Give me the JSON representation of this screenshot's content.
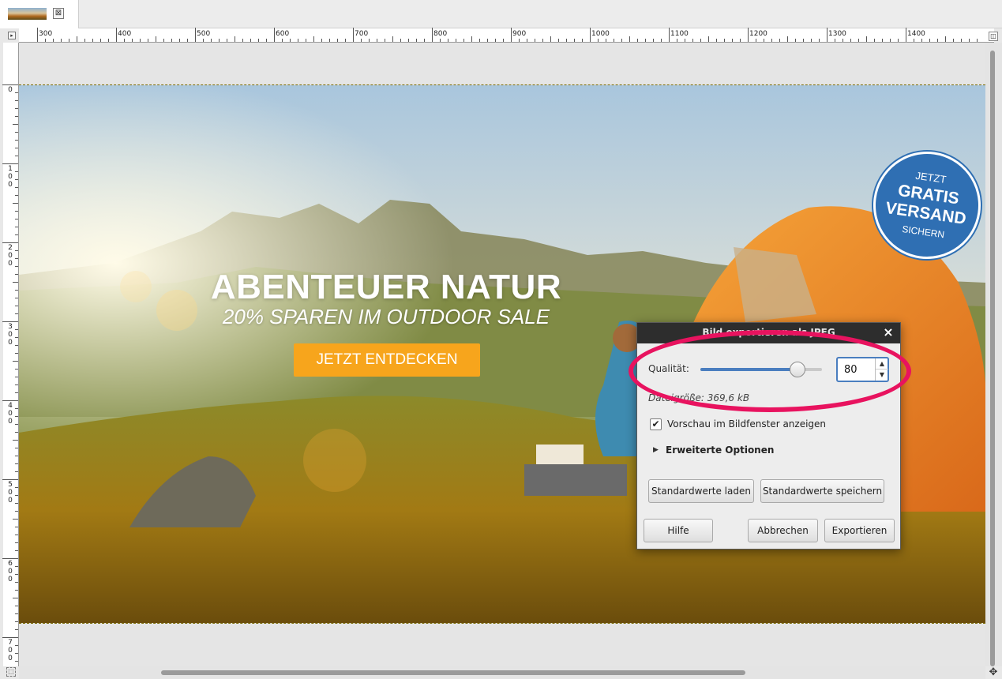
{
  "tab": {
    "close_glyph": "⊠",
    "thumb_icon": "image-thumbnail"
  },
  "ruler": {
    "h_labels": [
      "300",
      "400",
      "500",
      "600",
      "700",
      "800",
      "900",
      "1000",
      "1100",
      "1200",
      "1300",
      "1400"
    ],
    "v_labels": [
      "0",
      "100",
      "200",
      "300",
      "400",
      "500",
      "600",
      "700"
    ],
    "corner_glyph": "▸",
    "right_glyph": "◫"
  },
  "banner": {
    "headline": "ABENTEUER NATUR",
    "subline": "20% SPAREN IM OUTDOOR SALE",
    "cta": "JETZT ENTDECKEN",
    "badge": {
      "top": "JETZT",
      "mid1": "GRATIS",
      "mid2": "VERSAND",
      "bot": "SICHERN"
    }
  },
  "dialog": {
    "title": "Bild exportieren als JPEG",
    "close": "×",
    "quality_label": "Qualität:",
    "quality_value": "80",
    "quality_fraction": 0.8,
    "filesize": "Dateigröße: 369,6 kB",
    "preview_checkbox": "Vorschau im Bildfenster anzeigen",
    "preview_checked": true,
    "check_glyph": "✔",
    "advanced": "Erweiterte Optionen",
    "btn_load_defaults": "Standardwerte laden",
    "btn_save_defaults": "Standardwerte speichern",
    "btn_help": "Hilfe",
    "btn_cancel": "Abbrechen",
    "btn_export": "Exportieren",
    "spin_up": "▲",
    "spin_down": "▼",
    "expander_glyph": "▶"
  },
  "colors": {
    "annotation": "#e8135f",
    "cta": "#f7a51c",
    "badge": "#2f6fb3",
    "accent": "#4a7ebf"
  },
  "scroll": {
    "move_glyph": "✥",
    "nav_glyph": "⬚"
  }
}
